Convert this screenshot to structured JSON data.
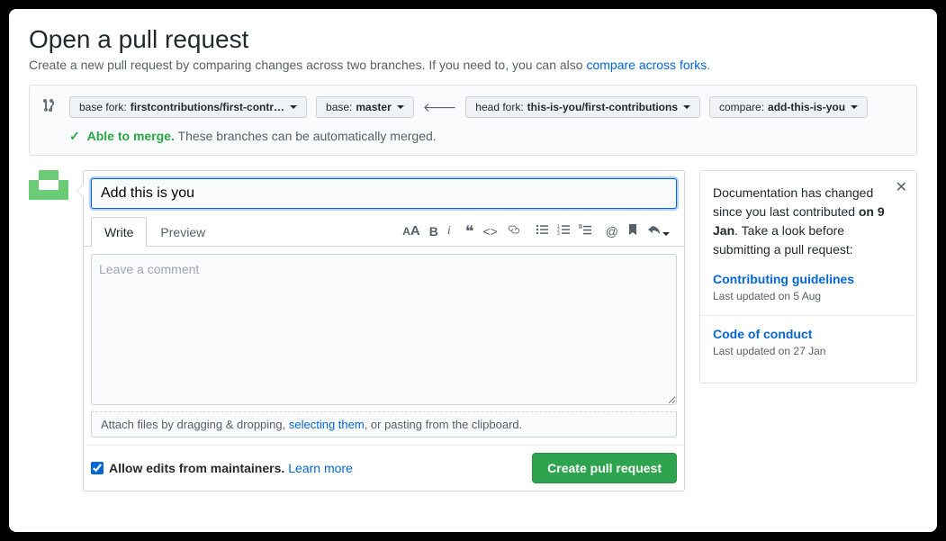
{
  "header": {
    "title": "Open a pull request",
    "subtitle_pre": "Create a new pull request by comparing changes across two branches. If you need to, you can also ",
    "subtitle_link": "compare across forks",
    "subtitle_post": "."
  },
  "compare": {
    "base_fork_label": "base fork: ",
    "base_fork_value": "firstcontributions/first-contr…",
    "base_label": "base: ",
    "base_value": "master",
    "head_fork_label": "head fork: ",
    "head_fork_value": "this-is-you/first-contributions",
    "compare_label": "compare: ",
    "compare_value": "add-this-is-you"
  },
  "merge": {
    "status_strong": "Able to merge.",
    "status_text": " These branches can be automatically merged."
  },
  "form": {
    "title_value": "Add this is you",
    "tab_write": "Write",
    "tab_preview": "Preview",
    "comment_placeholder": "Leave a comment",
    "attach_pre": "Attach files by dragging & dropping, ",
    "attach_link": "selecting them",
    "attach_post": ", or pasting from the clipboard.",
    "allow_edits_label": "Allow edits from maintainers.",
    "learn_more": "Learn more",
    "submit_label": "Create pull request"
  },
  "sidebar": {
    "notice_pre": "Documentation has changed since you last contributed ",
    "notice_date": "on 9 Jan",
    "notice_post": ". Take a look before submitting a pull request:",
    "link1": "Contributing guidelines",
    "link1_meta": "Last updated on 5 Aug",
    "link2": "Code of conduct",
    "link2_meta": "Last updated on 27 Jan"
  }
}
